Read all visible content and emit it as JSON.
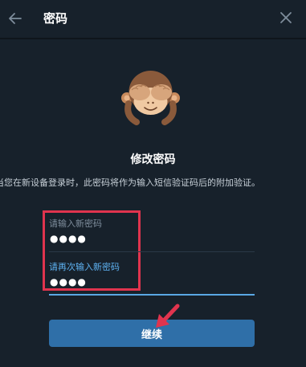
{
  "header": {
    "title": "密码",
    "back_icon": "arrow-left-icon",
    "close_icon": "close-icon"
  },
  "illustration": {
    "name": "see-no-evil-monkey"
  },
  "main": {
    "heading": "修改密码",
    "description": "当您在新设备登录时，此密码将作为输入短信验证码后的附加验证。"
  },
  "fields": [
    {
      "label": "请输入新密码",
      "value": "●●●●"
    },
    {
      "label": "请再次输入新密码",
      "value": "●●●●"
    }
  ],
  "actions": {
    "continue_label": "继续"
  },
  "colors": {
    "background": "#17212b",
    "accent": "#5eb2f2",
    "button": "#2f6fa8",
    "highlight_box": "#e0344e"
  }
}
